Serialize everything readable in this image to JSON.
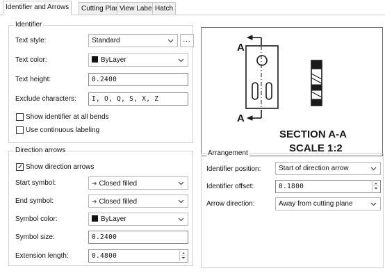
{
  "tabs": [
    {
      "label": "Identifier and Arrows"
    },
    {
      "label": "Cutting Plane"
    },
    {
      "label": "View Label"
    },
    {
      "label": "Hatch"
    }
  ],
  "identifier": {
    "legend": "Identifier",
    "text_style_label": "Text style:",
    "text_style_value": "Standard",
    "browse_label": "...",
    "text_color_label": "Text color:",
    "text_color_value": "ByLayer",
    "text_height_label": "Text height:",
    "text_height_value": "0.2400",
    "exclude_label": "Exclude characters:",
    "exclude_value": "I, O, Q, S, X, Z",
    "show_at_bends_label": "Show identifier at all bends",
    "show_at_bends_checked": false,
    "continuous_label": "Use continuous labeling",
    "continuous_checked": false
  },
  "direction_arrows": {
    "legend": "Direction arrows",
    "show_label": "Show direction arrows",
    "show_checked": true,
    "start_symbol_label": "Start symbol:",
    "start_symbol_value": "Closed filled",
    "end_symbol_label": "End symbol:",
    "end_symbol_value": "Closed filled",
    "symbol_color_label": "Symbol color:",
    "symbol_color_value": "ByLayer",
    "symbol_size_label": "Symbol size:",
    "symbol_size_value": "0.2400",
    "extension_length_label": "Extension length:",
    "extension_length_value": "0.4800"
  },
  "arrangement": {
    "legend": "Arrangement",
    "position_label": "Identifier position:",
    "position_value": "Start of direction arrow",
    "offset_label": "Identifier offset:",
    "offset_value": "0.1800",
    "arrow_direction_label": "Arrow direction:",
    "arrow_direction_value": "Away from cutting plane"
  },
  "preview": {
    "label_top": "A",
    "label_bottom": "A",
    "section_title": "SECTION A-A",
    "scale_text": "SCALE 1:2"
  },
  "colors": {
    "swatch": "#111111",
    "border": "#b8b8b8",
    "tab_inactive": "#f0f0f0"
  }
}
